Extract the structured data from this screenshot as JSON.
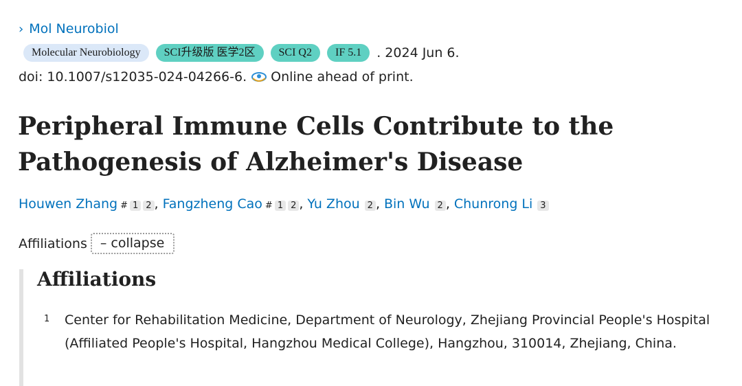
{
  "journal": {
    "chevron": "›",
    "name": "Mol Neurobiol"
  },
  "badges": [
    {
      "label": "Molecular Neurobiology",
      "color": "#dbe8f8"
    },
    {
      "label": "SCI升级版 医学2区",
      "color": "#5fd0c2"
    },
    {
      "label": "SCI Q2",
      "color": "#5fd0c2"
    },
    {
      "label": "IF 5.1",
      "color": "#5fd0c2"
    }
  ],
  "date_text": ". 2024 Jun 6.",
  "doi_text": "doi: 10.1007/s12035-024-04266-6.",
  "eprint_icon": "eye-epub-icon",
  "online_text": "Online ahead of print.",
  "title": "Peripheral Immune Cells Contribute to the Pathogenesis of Alzheimer's Disease",
  "authors": [
    {
      "name": "Houwen Zhang",
      "mark": "#",
      "affils": [
        "1",
        "2"
      ]
    },
    {
      "name": "Fangzheng Cao",
      "mark": "#",
      "affils": [
        "1",
        "2"
      ]
    },
    {
      "name": "Yu Zhou",
      "mark": "",
      "affils": [
        "2"
      ]
    },
    {
      "name": "Bin Wu",
      "mark": "",
      "affils": [
        "2"
      ]
    },
    {
      "name": "Chunrong Li",
      "mark": "",
      "affils": [
        "3"
      ]
    }
  ],
  "affiliations_label": "Affiliations",
  "collapse_label": "– collapse",
  "affiliations_heading": "Affiliations",
  "affiliation_items": [
    {
      "num": "1",
      "text": "Center for Rehabilitation Medicine, Department of Neurology, Zhejiang Provincial People's Hospital (Affiliated People's Hospital, Hangzhou Medical College), Hangzhou, 310014, Zhejiang, China."
    }
  ],
  "colors": {
    "link": "#0071bc",
    "text": "#212121",
    "badge_blue": "#dbe8f8",
    "badge_teal": "#5fd0c2"
  }
}
